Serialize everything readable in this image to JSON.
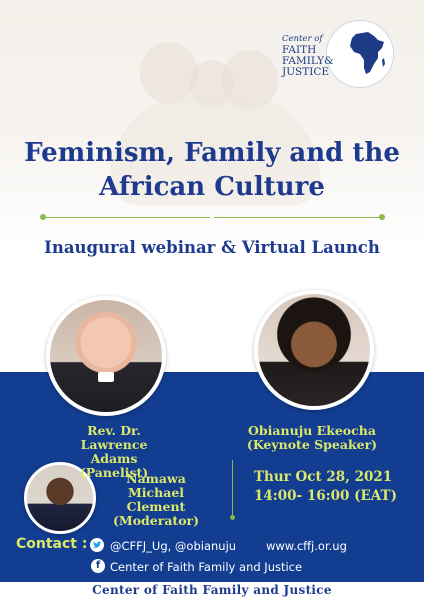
{
  "logo": {
    "line1": "Center of",
    "line2": "FAITH",
    "line3": "FAMILY&",
    "line4": "JUSTICE"
  },
  "title": {
    "line1": "Feminism, Family and the",
    "line2": "African Culture"
  },
  "subtitle": "Inaugural webinar & Virtual Launch",
  "speakers": [
    {
      "name_line1": "Rev. Dr. Lawrence",
      "name_line2": "Adams",
      "role": "(Panelist)"
    },
    {
      "name_line1": "Obianuju Ekeocha",
      "role": "(Keynote Speaker)"
    },
    {
      "name_line1": "Namawa Michael",
      "name_line2": "Clement",
      "role": "(Moderator)"
    }
  ],
  "event": {
    "date": "Thur Oct 28, 2021",
    "time": "14:00- 16:00 (EAT)"
  },
  "contact": {
    "label": "Contact :",
    "twitter_handles": "@CFFJ_Ug,  @obianuju",
    "website": "www.cffj.or.ug",
    "facebook_name": "Center of Faith Family and Justice"
  },
  "footer": "Center of Faith Family and Justice",
  "colors": {
    "brand_blue": "#123d91",
    "title_blue": "#1e3a8e",
    "accent_yellow": "#dbe86a",
    "accent_green": "#8ab84a"
  },
  "icons": [
    "twitter-icon",
    "facebook-icon",
    "africa-map-icon"
  ]
}
